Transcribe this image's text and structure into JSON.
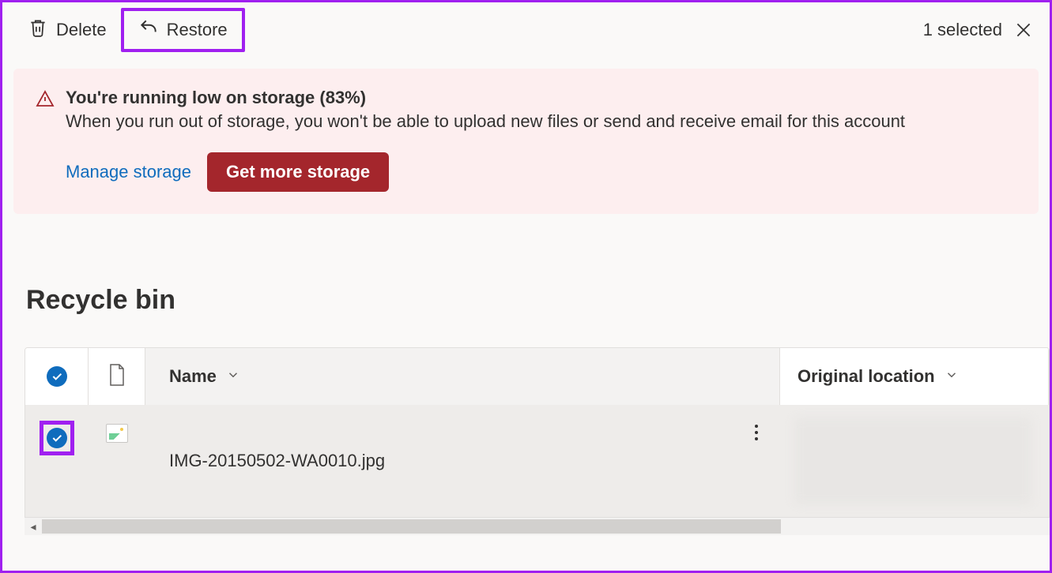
{
  "toolbar": {
    "delete_label": "Delete",
    "restore_label": "Restore",
    "selected_text": "1 selected"
  },
  "banner": {
    "title": "You're running low on storage (83%)",
    "body": "When you run out of storage, you won't be able to upload new files or send and receive email for this account",
    "manage_label": "Manage storage",
    "get_more_label": "Get more storage"
  },
  "page": {
    "title": "Recycle bin"
  },
  "table": {
    "columns": {
      "name": "Name",
      "original_location": "Original location"
    },
    "rows": [
      {
        "filename": "IMG-20150502-WA0010.jpg"
      }
    ]
  }
}
